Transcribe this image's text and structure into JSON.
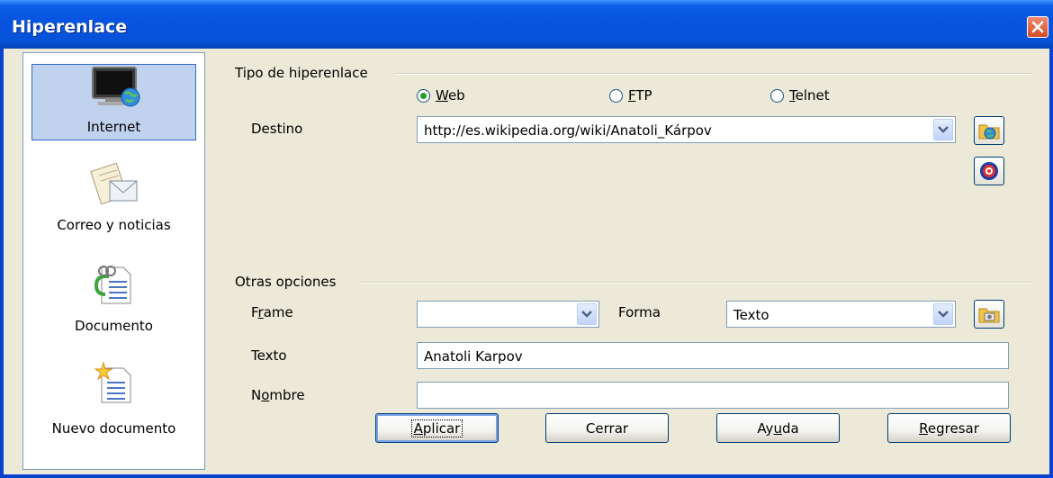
{
  "window": {
    "title": "Hiperenlace"
  },
  "categories": [
    {
      "label": "Internet",
      "icon": "internet-monitor-icon",
      "selected": true
    },
    {
      "label": "Correo y noticias",
      "icon": "mail-icon",
      "selected": false
    },
    {
      "label": "Documento",
      "icon": "document-icon",
      "selected": false
    },
    {
      "label": "Nuevo documento",
      "icon": "new-document-icon",
      "selected": false
    }
  ],
  "hyperlink_type": {
    "group_label": "Tipo de hiperenlace",
    "options": [
      "Web",
      "FTP",
      "Telnet"
    ],
    "selected": "Web"
  },
  "destination": {
    "label": "Destino",
    "value": "http://es.wikipedia.org/wiki/Anatoli_Kárpov"
  },
  "other_options": {
    "group_label": "Otras opciones",
    "frame_label": "Frame",
    "frame_value": "",
    "form_label": "Forma",
    "form_value": "Texto",
    "text_label": "Texto",
    "text_value": "Anatoli Karpov",
    "name_label": "Nombre",
    "name_value": ""
  },
  "buttons": {
    "apply": "Aplicar",
    "close": "Cerrar",
    "help": "Ayuda",
    "back": "Regresar"
  },
  "colors": {
    "title_bar": "#0854e0",
    "selection": "#c1d2ee",
    "radio_dot": "#21a121",
    "close_button": "#d54a26"
  }
}
